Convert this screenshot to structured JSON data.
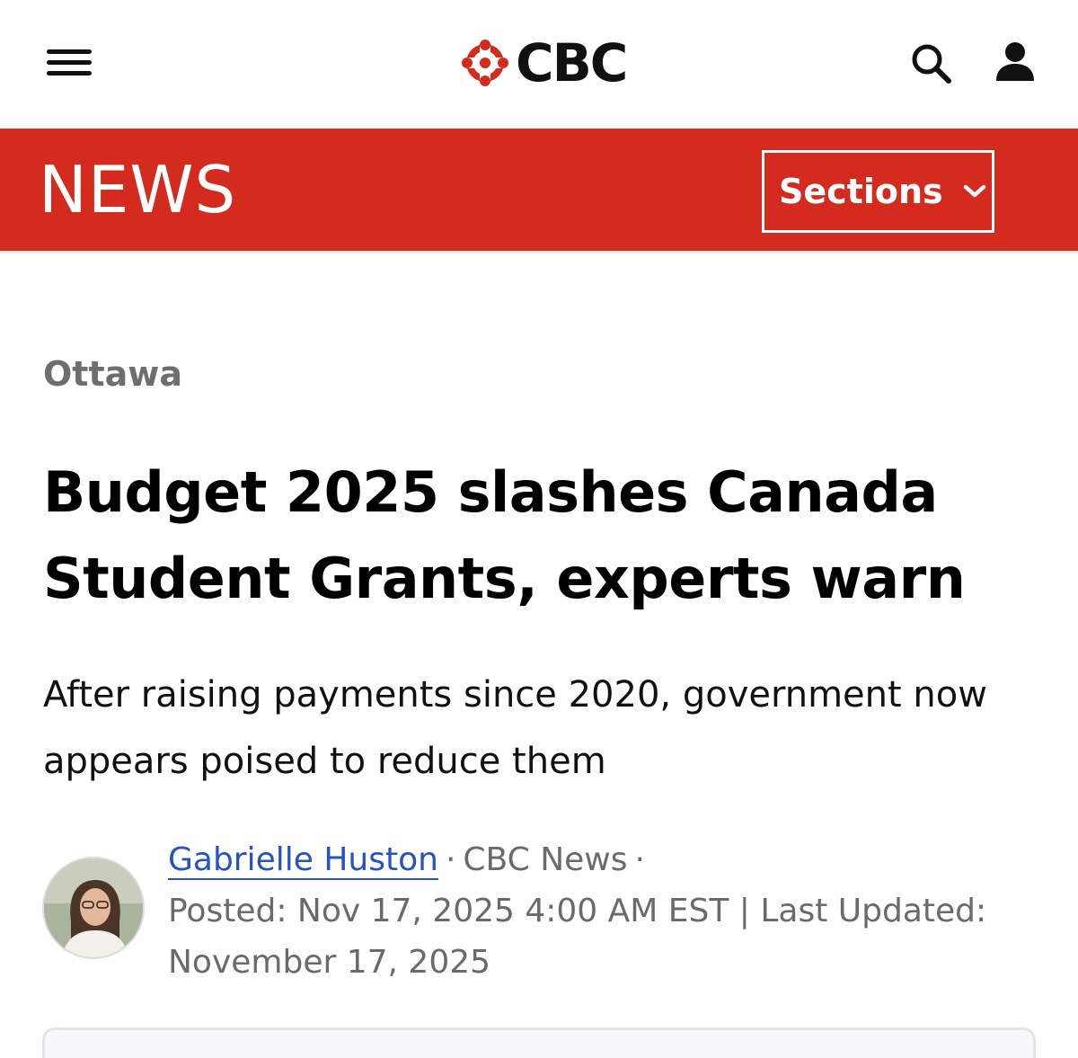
{
  "header": {
    "logo_text": "CBC",
    "icons": {
      "menu": "hamburger-menu-icon",
      "search": "search-icon",
      "account": "user-account-icon",
      "logo": "cbc-gem-logo"
    },
    "colors": {
      "brand_red": "#d52b1e",
      "text_dark": "#111111"
    }
  },
  "newsbar": {
    "title": "NEWS",
    "sections_label": "Sections",
    "sections_icon": "chevron-down-icon"
  },
  "article": {
    "section": "Ottawa",
    "headline": "Budget 2025 slashes Canada Student Grants, experts warn",
    "deck": "After raising payments since 2020, government now appears poised to reduce them",
    "byline": {
      "author": "Gabrielle Huston",
      "outlet": "CBC News",
      "separator": "·",
      "posted": "Posted: Nov 17, 2025 4:00 AM EST | Last Updated: November 17, 2025"
    },
    "colors": {
      "link": "#2753c0",
      "meta_gray": "#6a6a6a",
      "section_gray": "#6e6e6e"
    }
  }
}
